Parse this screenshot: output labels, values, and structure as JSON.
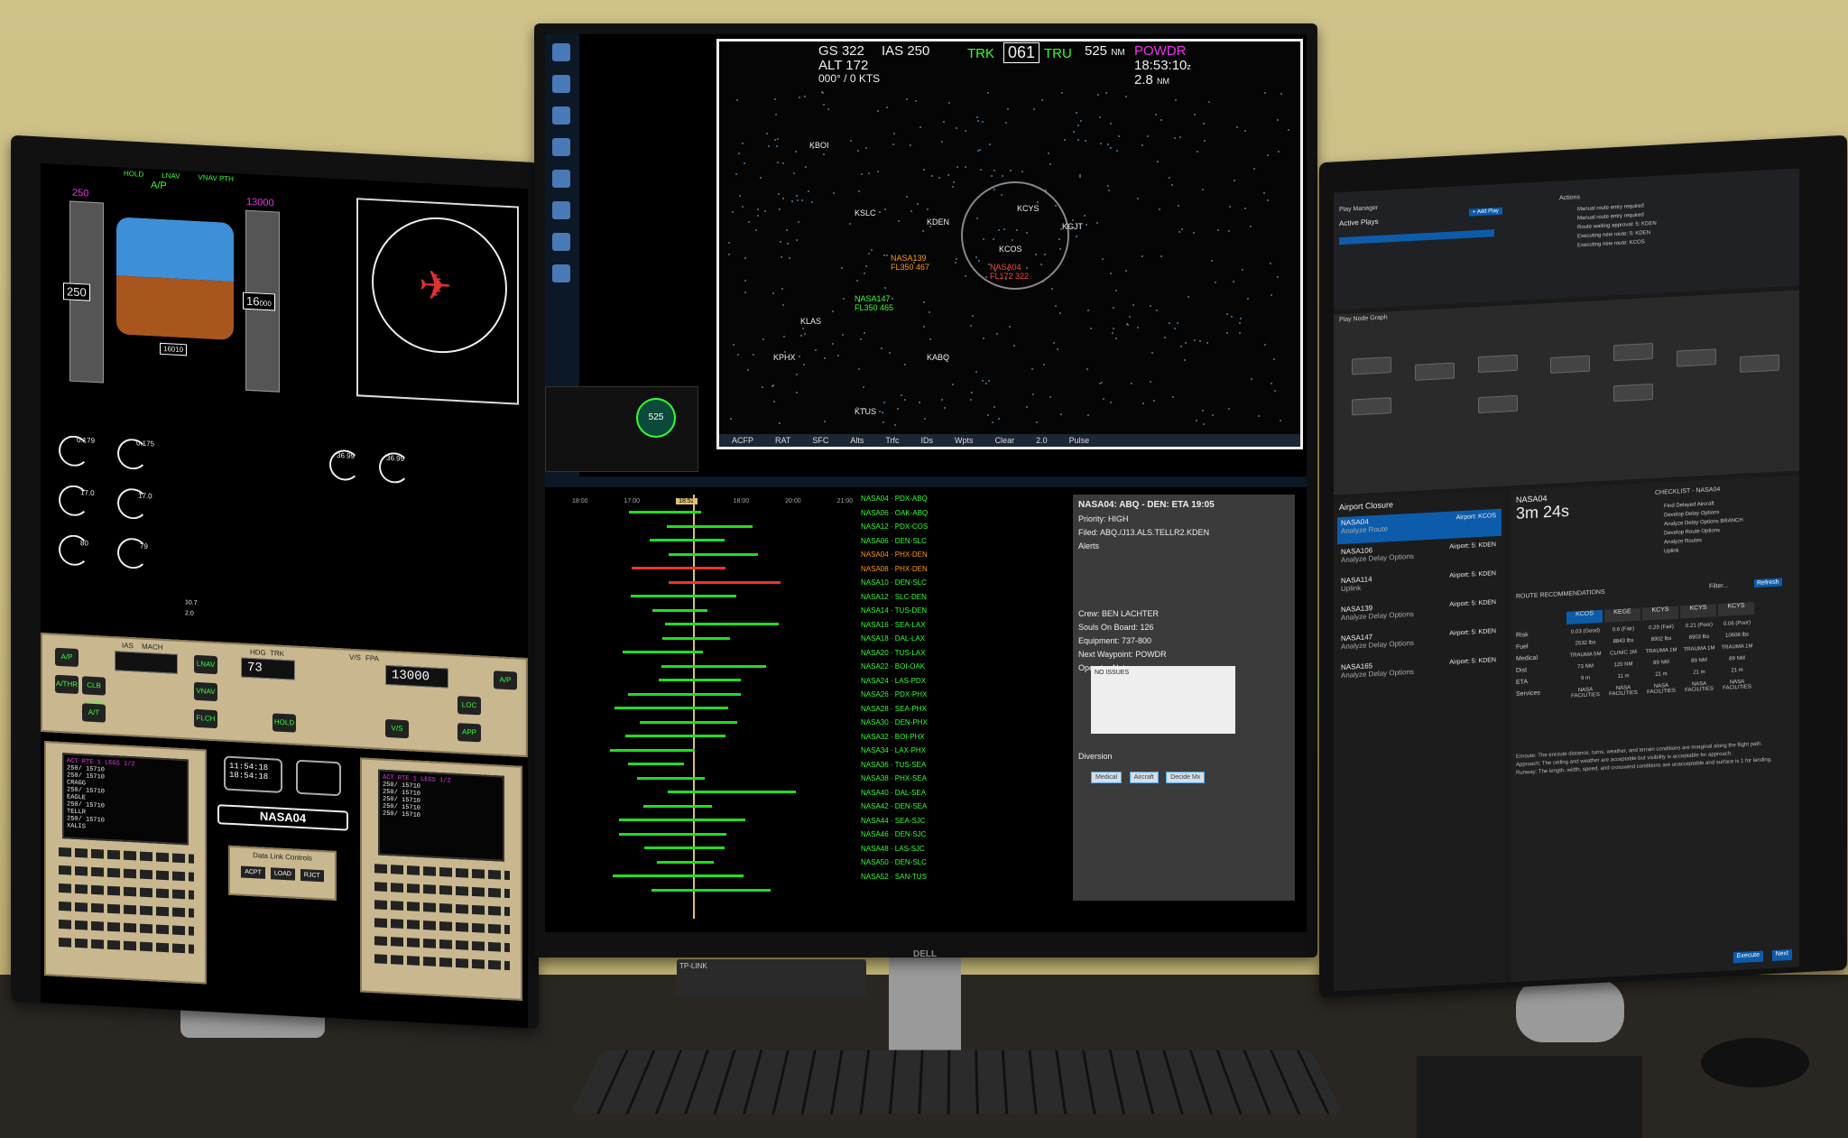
{
  "left": {
    "pfd": {
      "speed_bug": "250",
      "speed_current": "250",
      "alt_current": "16",
      "alt_sub": "000",
      "alt_target": "13000",
      "ap_label": "A/P",
      "modes": [
        "HOLD",
        "LNAV",
        "VNAV PTH"
      ],
      "heading_readout": "16010"
    },
    "engines": {
      "n1_left": "0.179",
      "n1_right": "0.175",
      "n2_left": "17.0",
      "n2_right": "17.0",
      "egt_left": "80",
      "egt_right": "79",
      "epr_left": "36.99",
      "epr_right": "36.99",
      "total_fuel": "10.7",
      "fuel_flow": "2.0"
    },
    "mcp": {
      "ias_label": "IAS",
      "mach_label": "MACH",
      "hdg_label": "HDG",
      "trk_label": "TRK",
      "vs_label": "V/S",
      "fpa_label": "FPA",
      "hdg_value": "73",
      "alt_value": "13000",
      "buttons": [
        "A/P",
        "A/THR",
        "CLB CON",
        "A/T",
        "LNAV",
        "VNAV",
        "FLCH",
        "HOLD",
        "LOC",
        "APP",
        "V/S",
        "A/P"
      ]
    },
    "cdu_left": {
      "title": "ACT RTE 1 LEGS",
      "page": "1/2",
      "lines": [
        "250/ 15710",
        "250/ 15710",
        "CRAGG",
        "250/ 15710",
        "EAGLE",
        "250/ 15710",
        "TELLR",
        "250/ 15710",
        "XALIS"
      ]
    },
    "cdu_right": {
      "title": "ACT RTE 1 LEGS",
      "page": "1/2",
      "lines": [
        "250/ 15710",
        "250/ 15710",
        "250/ 15710",
        "250/ 15710",
        "250/ 15710"
      ]
    },
    "clock_1": "11:54:18",
    "clock_2": "18:54:18",
    "callsign": "NASA04",
    "datalink_title": "Data Link Controls",
    "datalink_buttons": [
      "ACPT",
      "LOAD",
      "RJCT"
    ]
  },
  "center": {
    "map": {
      "gs": "GS 322",
      "ias": "IAS 250",
      "alt": "ALT 172",
      "hdg_small": "000° / 0 KTS",
      "trk_label": "TRK",
      "trk_value": "061",
      "tru_label": "TRU",
      "dist": "525",
      "dist_unit": "NM",
      "waypoint": "POWDR",
      "time": "18:53:10",
      "time_sfx": "z",
      "eta_dist": "2.8",
      "eta_unit": "NM",
      "aircraft": [
        {
          "id": "NASA139",
          "alt": "FL350 467",
          "color": "orange"
        },
        {
          "id": "NASA147",
          "alt": "FL350 465",
          "color": "green"
        },
        {
          "id": "NASA04",
          "alt": "FL172 322",
          "color": "red"
        }
      ],
      "airports": [
        "KDEN",
        "KCYS",
        "KCOS",
        "KSLC",
        "KLAS",
        "KPHX",
        "KABQ",
        "KTUS",
        "KBOI",
        "KGJT"
      ],
      "toolbar": [
        "ACFP",
        "RAT",
        "SFC",
        "Alts",
        "Trfc",
        "IDs",
        "Wpts",
        "Clear",
        "2.0",
        "Pulse"
      ],
      "mini_range": "525"
    },
    "timeline": {
      "times": [
        "18:00",
        "17:00",
        "18:52",
        "18:00",
        "20:00",
        "21:00"
      ],
      "now": "18:52"
    },
    "flights": [
      "NASA04 · PDX-ABQ",
      "NASA06 · OAK-ABQ",
      "NASA12 · PDX-COS",
      "NASA06 · DEN-SLC",
      "NASA04 · PHX-DEN",
      "NASA08 · PHX-DEN",
      "NASA10 · DEN-SLC",
      "NASA12 · SLC-DEN",
      "NASA14 · TUS-DEN",
      "NASA16 · SEA-LAX",
      "NASA18 · DAL-LAX",
      "NASA20 · TUS-LAX",
      "NASA22 · BOI-OAK",
      "NASA24 · LAS-PDX",
      "NASA26 · PDX-PHX",
      "NASA28 · SEA-PHX",
      "NASA30 · DEN-PHX",
      "NASA32 · BOI-PHX",
      "NASA34 · LAX-PHX",
      "NASA36 · TUS-SEA",
      "NASA38 · PHX-SEA",
      "NASA40 · DAL-SEA",
      "NASA42 · DEN-SEA",
      "NASA44 · SEA-SJC",
      "NASA46 · DEN-SJC",
      "NASA48 · LAS-SJC",
      "NASA50 · DEN-SLC",
      "NASA52 · SAN-TUS"
    ],
    "detail": {
      "header": "NASA04: ABQ - DEN: ETA 19:05",
      "priority": "Priority: HIGH",
      "filed": "Filed: ABQ./J13.ALS.TELLR2.KDEN",
      "alerts": "Alerts",
      "crew": "Crew: BEN LACHTER",
      "souls": "Souls On Board: 126",
      "equipment": "Equipment: 737-800",
      "next_wp": "Next Waypoint: POWDR",
      "notes_label": "Operator Notes",
      "notes_text": "NO ISSUES",
      "diversion": "Diversion",
      "diversion_buttons": [
        "Medical",
        "Aircraft",
        "Decide Mx"
      ]
    }
  },
  "right": {
    "play_manager": "Play Manager",
    "active_plays": "Active Plays",
    "add_play": "+ Add Play",
    "actions_title": "Actions",
    "actions": [
      "Manual route entry required",
      "Manual route entry required",
      "Route waiting approval: 5: KDEN",
      "Executing new route: 5: KDEN",
      "Executing new route: KCOS"
    ],
    "play_node_graph": "Play Node Graph",
    "closure_title": "Airport Closure",
    "closure_items": [
      {
        "id": "NASA04",
        "sub": "Analyze Route",
        "score": "Airport: KCOS"
      },
      {
        "id": "NASA106",
        "sub": "Analyze Delay Options",
        "score": "Airport: 5: KDEN"
      },
      {
        "id": "NASA114",
        "sub": "Uplink",
        "score": "Airport: 5: KDEN"
      },
      {
        "id": "NASA139",
        "sub": "Analyze Delay Options",
        "score": "Airport: 5: KDEN"
      },
      {
        "id": "NASA147",
        "sub": "Analyze Delay Options",
        "score": "Airport: 5: KDEN"
      },
      {
        "id": "NASA165",
        "sub": "Analyze Delay Options",
        "score": "Airport: 5: KDEN"
      }
    ],
    "selected_flight": "NASA04",
    "elapsed": "3m 24s",
    "checklist_title": "CHECKLIST - NASA04",
    "checklist": [
      "Find Delayed Aircraft",
      "Develop Delay Options",
      "Analyze Delay Options BRANCH",
      "Develop Route Options",
      "Analyze Routes",
      "Uplink"
    ],
    "route_rec_title": "ROUTE RECOMMENDATIONS",
    "route_cols": [
      "KCOS",
      "KEGE",
      "KCYS",
      "KCYS",
      "KCYS"
    ],
    "route_rows": [
      {
        "label": "Risk",
        "vals": [
          "0.03 (Good)",
          "0.6 (Fair)",
          "0.29 (Fair)",
          "0.21 (Poor)",
          "0.06 (Poor)"
        ]
      },
      {
        "label": "Fuel",
        "vals": [
          "2532 lbs",
          "8843 lbs",
          "8902 lbs",
          "8903 lbs",
          "10608 lbs"
        ]
      },
      {
        "label": "Medical",
        "vals": [
          "TRAUMA 5M",
          "CLINIC 1M",
          "TRAUMA 1M",
          "TRAUMA 1M",
          "TRAUMA 1M"
        ]
      },
      {
        "label": "Dist",
        "vals": [
          "73 NM",
          "120 NM",
          "89 NM",
          "89 NM",
          "89 NM"
        ]
      },
      {
        "label": "ETA",
        "vals": [
          "9 m",
          "11 m",
          "21 m",
          "21 m",
          "21 m"
        ]
      },
      {
        "label": "Services",
        "vals": [
          "NASA FACILITIES",
          "NASA FACILITIES",
          "NASA FACILITIES",
          "NASA FACILITIES",
          "NASA FACILITIES"
        ]
      }
    ],
    "notes": [
      "Enroute: The enroute distance, turns, weather, and terrain conditions are marginal along the flight path.",
      "Approach: The ceiling and weather are acceptable but visibility is acceptable for approach.",
      "Runway: The length, width, speed, and crosswind conditions are unacceptable and surface is 1 for landing."
    ],
    "filter": "Filter...",
    "refresh": "Refresh",
    "execute": "Execute",
    "next": "Next"
  },
  "brand": "DELL",
  "router_brand": "TP-LINK"
}
